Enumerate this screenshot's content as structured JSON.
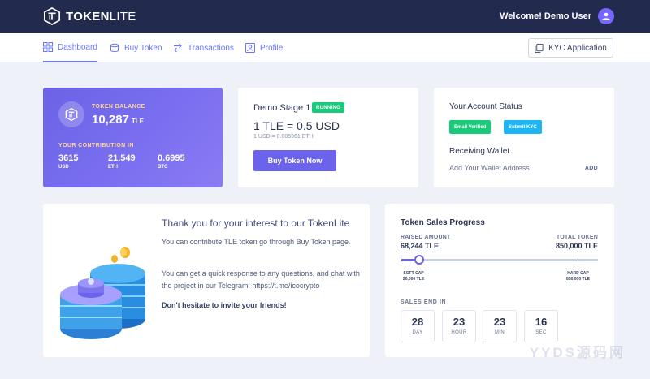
{
  "brand": {
    "name_bold": "TOKEN",
    "name_thin": "LITE"
  },
  "header": {
    "welcome": "Welcome! Demo User",
    "avatar_icon": "user-icon"
  },
  "nav": {
    "items": [
      {
        "label": "Dashboard",
        "icon": "grid-icon",
        "active": true
      },
      {
        "label": "Buy Token",
        "icon": "coins-icon"
      },
      {
        "label": "Transactions",
        "icon": "transfer-icon"
      },
      {
        "label": "Profile",
        "icon": "profile-icon"
      }
    ],
    "kyc_button": "KYC Application"
  },
  "balance": {
    "label": "TOKEN BALANCE",
    "value": "10,287",
    "unit": "TLE",
    "contribution_label": "YOUR CONTRIBUTION IN",
    "contributions": [
      {
        "value": "3615",
        "unit": "USD"
      },
      {
        "value": "21.549",
        "unit": "ETH"
      },
      {
        "value": "0.6995",
        "unit": "BTC"
      }
    ]
  },
  "stage": {
    "title": "Demo Stage 1",
    "badge": "RUNNING",
    "rate": "1 TLE = 0.5 USD",
    "rate_sub": "1 USD = 0.005961 ETH",
    "buy_button": "Buy Token Now"
  },
  "account_status": {
    "title": "Your Account Status",
    "badge_email": "Email Verified",
    "badge_kyc": "Submit KYC",
    "wallet_title": "Receiving Wallet",
    "wallet_text": "Add Your Wallet Address",
    "wallet_link": "ADD",
    "colors": {
      "email": "#1bc97a",
      "kyc": "#1eb6f2"
    }
  },
  "thanks": {
    "title": "Thank you for your interest to our TokenLite",
    "para1": "You can contribute TLE token go through Buy Token page.",
    "para2": "You can get a quick response to any questions, and chat with the project in our Telegram: https://t.me/icocrypto",
    "strong": "Don't hesitate to invite your friends!"
  },
  "progress": {
    "title": "Token Sales Progress",
    "raised_label": "RAISED AMOUNT",
    "raised_value": "68,244 TLE",
    "total_label": "TOTAL TOKEN",
    "total_value": "850,000 TLE",
    "fill_fraction": 0.09,
    "soft_cap_label": "SOFT CAP",
    "soft_cap_value": "20,000 TLE",
    "hard_cap_label": "HARD CAP",
    "hard_cap_value": "850,000 TLE",
    "sales_end": "SALES END IN",
    "countdown": [
      {
        "value": "28",
        "unit": "DAY"
      },
      {
        "value": "23",
        "unit": "HOUR"
      },
      {
        "value": "23",
        "unit": "MIN"
      },
      {
        "value": "16",
        "unit": "SEC"
      }
    ]
  },
  "watermark": "YYDS源码网"
}
